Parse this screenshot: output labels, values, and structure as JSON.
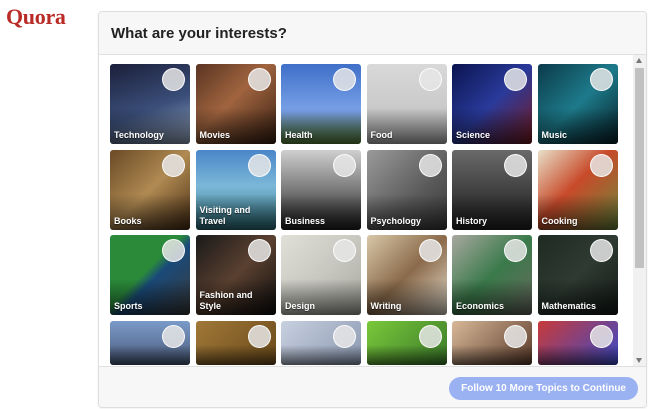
{
  "app": {
    "logo": "Quora",
    "brand_color": "#b92b27"
  },
  "modal": {
    "title": "What are your interests?",
    "continue_label": "Follow 10 More Topics to Continue",
    "continue_color": "#9ab1f2"
  },
  "topics": [
    {
      "label": "Technology",
      "bg": "linear-gradient(160deg,#1b1f3a 0%,#3b4f7a 55%,#9fb0c8 100%)"
    },
    {
      "label": "Movies",
      "bg": "linear-gradient(135deg,#5a3422 0%,#a0643f 45%,#3a2012 100%)"
    },
    {
      "label": "Health",
      "bg": "linear-gradient(180deg,#3f6fc8 0%,#7aa2e8 60%,#5d8a3a 100%)"
    },
    {
      "label": "Food",
      "bg": "linear-gradient(180deg,#d9d9d9 0%,#bdbdbd 100%)"
    },
    {
      "label": "Science",
      "bg": "linear-gradient(135deg,#0a1450 0%,#2a3a9a 50%,#7a1a20 100%)"
    },
    {
      "label": "Music",
      "bg": "linear-gradient(135deg,#0c3a4a 0%,#1d7a8a 50%,#062028 100%)"
    },
    {
      "label": "Books",
      "bg": "linear-gradient(135deg,#6a4a26 0%,#b08a52 50%,#4a2f15 100%)"
    },
    {
      "label": "Visiting and Travel",
      "bg": "linear-gradient(180deg,#4a86c8 0%,#7bb8d8 45%,#2d6f7a 100%)"
    },
    {
      "label": "Business",
      "bg": "linear-gradient(180deg,#cfcfcf 0%,#8a8a8a 40%,#222 100%)"
    },
    {
      "label": "Psychology",
      "bg": "linear-gradient(135deg,#9a9a9a 0%,#5a5a5a 60%,#3a3a3a 100%)"
    },
    {
      "label": "History",
      "bg": "linear-gradient(180deg,#6a6a6a 0%,#3a3a3a 60%,#222 100%)"
    },
    {
      "label": "Cooking",
      "bg": "linear-gradient(135deg,#e8e0c8 0%,#c84a2a 45%,#6a8a3a 100%)"
    },
    {
      "label": "Sports",
      "bg": "linear-gradient(135deg,#2a8a3a 0%,#2a8a3a 45%,#1a4a7a 55%,#3a3a3a 100%)"
    },
    {
      "label": "Fashion and Style",
      "bg": "linear-gradient(135deg,#1a1a1a 0%,#5a4030 50%,#0e0e0e 100%)"
    },
    {
      "label": "Design",
      "bg": "linear-gradient(135deg,#e0e0d8 0%,#c8c8c0 50%,#a8a8a0 100%)"
    },
    {
      "label": "Writing",
      "bg": "linear-gradient(135deg,#d8c8a8 0%,#8a6a4a 50%,#e8e0d0 100%)"
    },
    {
      "label": "Economics",
      "bg": "linear-gradient(135deg,#a8a8a0 0%,#3a7a4a 50%,#6a6a60 100%)"
    },
    {
      "label": "Mathematics",
      "bg": "linear-gradient(135deg,#1e2a22 0%,#2e3a32 50%,#141a16 100%)"
    },
    {
      "label": "",
      "bg": "linear-gradient(180deg,#7a9ac8 0%,#4a5a7a 100%)"
    },
    {
      "label": "",
      "bg": "linear-gradient(135deg,#a07838 0%,#6a4a1a 100%)"
    },
    {
      "label": "",
      "bg": "linear-gradient(135deg,#c8d0e0 0%,#8a98b0 100%)"
    },
    {
      "label": "",
      "bg": "linear-gradient(135deg,#7ac83a 0%,#3a7a2a 100%)"
    },
    {
      "label": "",
      "bg": "linear-gradient(135deg,#d8b898 0%,#5a3a2a 100%)"
    },
    {
      "label": "",
      "bg": "linear-gradient(135deg,#c83a3a 0%,#3a4ac8 100%)"
    }
  ]
}
